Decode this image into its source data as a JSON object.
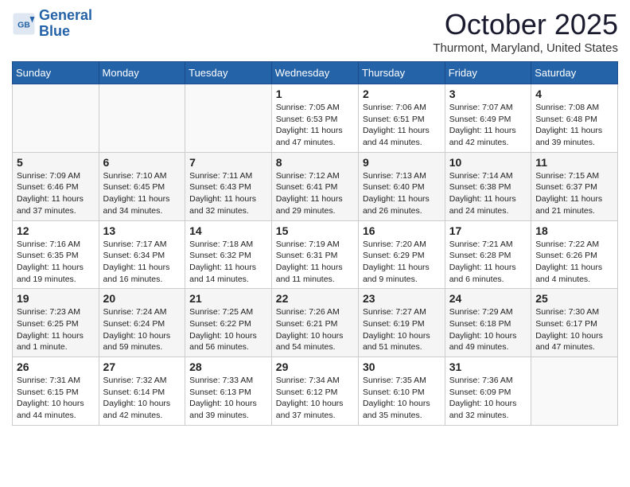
{
  "header": {
    "logo_line1": "General",
    "logo_line2": "Blue",
    "month": "October 2025",
    "location": "Thurmont, Maryland, United States"
  },
  "weekdays": [
    "Sunday",
    "Monday",
    "Tuesday",
    "Wednesday",
    "Thursday",
    "Friday",
    "Saturday"
  ],
  "weeks": [
    [
      {
        "day": "",
        "info": ""
      },
      {
        "day": "",
        "info": ""
      },
      {
        "day": "",
        "info": ""
      },
      {
        "day": "1",
        "info": "Sunrise: 7:05 AM\nSunset: 6:53 PM\nDaylight: 11 hours\nand 47 minutes."
      },
      {
        "day": "2",
        "info": "Sunrise: 7:06 AM\nSunset: 6:51 PM\nDaylight: 11 hours\nand 44 minutes."
      },
      {
        "day": "3",
        "info": "Sunrise: 7:07 AM\nSunset: 6:49 PM\nDaylight: 11 hours\nand 42 minutes."
      },
      {
        "day": "4",
        "info": "Sunrise: 7:08 AM\nSunset: 6:48 PM\nDaylight: 11 hours\nand 39 minutes."
      }
    ],
    [
      {
        "day": "5",
        "info": "Sunrise: 7:09 AM\nSunset: 6:46 PM\nDaylight: 11 hours\nand 37 minutes."
      },
      {
        "day": "6",
        "info": "Sunrise: 7:10 AM\nSunset: 6:45 PM\nDaylight: 11 hours\nand 34 minutes."
      },
      {
        "day": "7",
        "info": "Sunrise: 7:11 AM\nSunset: 6:43 PM\nDaylight: 11 hours\nand 32 minutes."
      },
      {
        "day": "8",
        "info": "Sunrise: 7:12 AM\nSunset: 6:41 PM\nDaylight: 11 hours\nand 29 minutes."
      },
      {
        "day": "9",
        "info": "Sunrise: 7:13 AM\nSunset: 6:40 PM\nDaylight: 11 hours\nand 26 minutes."
      },
      {
        "day": "10",
        "info": "Sunrise: 7:14 AM\nSunset: 6:38 PM\nDaylight: 11 hours\nand 24 minutes."
      },
      {
        "day": "11",
        "info": "Sunrise: 7:15 AM\nSunset: 6:37 PM\nDaylight: 11 hours\nand 21 minutes."
      }
    ],
    [
      {
        "day": "12",
        "info": "Sunrise: 7:16 AM\nSunset: 6:35 PM\nDaylight: 11 hours\nand 19 minutes."
      },
      {
        "day": "13",
        "info": "Sunrise: 7:17 AM\nSunset: 6:34 PM\nDaylight: 11 hours\nand 16 minutes."
      },
      {
        "day": "14",
        "info": "Sunrise: 7:18 AM\nSunset: 6:32 PM\nDaylight: 11 hours\nand 14 minutes."
      },
      {
        "day": "15",
        "info": "Sunrise: 7:19 AM\nSunset: 6:31 PM\nDaylight: 11 hours\nand 11 minutes."
      },
      {
        "day": "16",
        "info": "Sunrise: 7:20 AM\nSunset: 6:29 PM\nDaylight: 11 hours\nand 9 minutes."
      },
      {
        "day": "17",
        "info": "Sunrise: 7:21 AM\nSunset: 6:28 PM\nDaylight: 11 hours\nand 6 minutes."
      },
      {
        "day": "18",
        "info": "Sunrise: 7:22 AM\nSunset: 6:26 PM\nDaylight: 11 hours\nand 4 minutes."
      }
    ],
    [
      {
        "day": "19",
        "info": "Sunrise: 7:23 AM\nSunset: 6:25 PM\nDaylight: 11 hours\nand 1 minute."
      },
      {
        "day": "20",
        "info": "Sunrise: 7:24 AM\nSunset: 6:24 PM\nDaylight: 10 hours\nand 59 minutes."
      },
      {
        "day": "21",
        "info": "Sunrise: 7:25 AM\nSunset: 6:22 PM\nDaylight: 10 hours\nand 56 minutes."
      },
      {
        "day": "22",
        "info": "Sunrise: 7:26 AM\nSunset: 6:21 PM\nDaylight: 10 hours\nand 54 minutes."
      },
      {
        "day": "23",
        "info": "Sunrise: 7:27 AM\nSunset: 6:19 PM\nDaylight: 10 hours\nand 51 minutes."
      },
      {
        "day": "24",
        "info": "Sunrise: 7:29 AM\nSunset: 6:18 PM\nDaylight: 10 hours\nand 49 minutes."
      },
      {
        "day": "25",
        "info": "Sunrise: 7:30 AM\nSunset: 6:17 PM\nDaylight: 10 hours\nand 47 minutes."
      }
    ],
    [
      {
        "day": "26",
        "info": "Sunrise: 7:31 AM\nSunset: 6:15 PM\nDaylight: 10 hours\nand 44 minutes."
      },
      {
        "day": "27",
        "info": "Sunrise: 7:32 AM\nSunset: 6:14 PM\nDaylight: 10 hours\nand 42 minutes."
      },
      {
        "day": "28",
        "info": "Sunrise: 7:33 AM\nSunset: 6:13 PM\nDaylight: 10 hours\nand 39 minutes."
      },
      {
        "day": "29",
        "info": "Sunrise: 7:34 AM\nSunset: 6:12 PM\nDaylight: 10 hours\nand 37 minutes."
      },
      {
        "day": "30",
        "info": "Sunrise: 7:35 AM\nSunset: 6:10 PM\nDaylight: 10 hours\nand 35 minutes."
      },
      {
        "day": "31",
        "info": "Sunrise: 7:36 AM\nSunset: 6:09 PM\nDaylight: 10 hours\nand 32 minutes."
      },
      {
        "day": "",
        "info": ""
      }
    ]
  ]
}
